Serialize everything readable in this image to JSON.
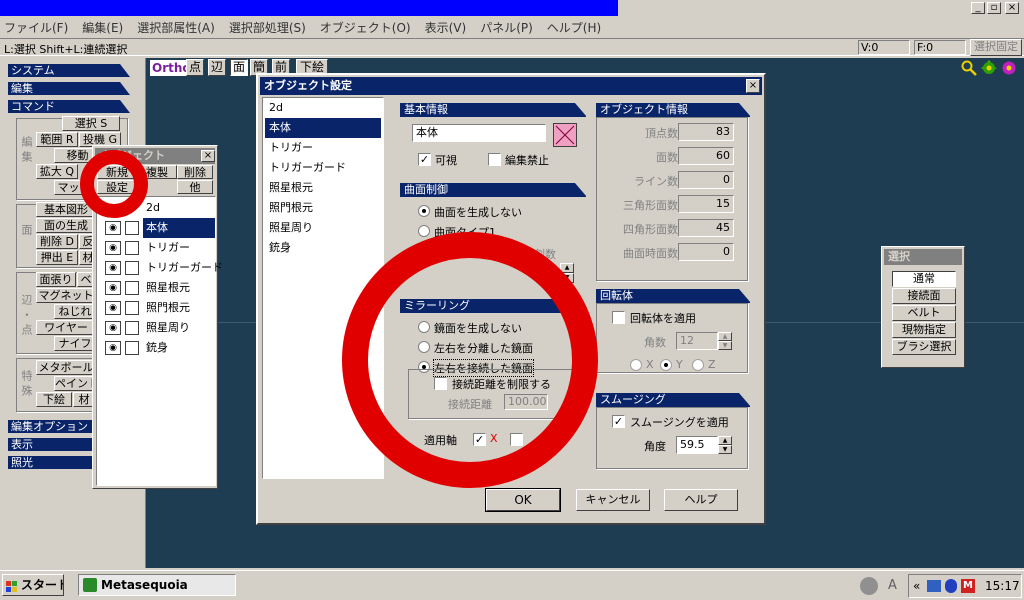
{
  "colors": {
    "title_active": "#0a246a",
    "viewport": "#1e3c52",
    "red_annotation": "#e00000",
    "light_icon": "#e8a000",
    "menu": "#d4d0c8"
  },
  "menubar": {
    "items": [
      "ファイル(F)",
      "編集(E)",
      "選択部属性(A)",
      "選択部処理(S)",
      "オブジェクト(O)",
      "表示(V)",
      "パネル(P)",
      "ヘルプ(H)"
    ]
  },
  "statusbar": {
    "hint": "L:選択  Shift+L:連続選択",
    "v": "V:0",
    "f": "F:0",
    "fixed": "選択固定"
  },
  "left_panel": {
    "headers": [
      "システム",
      "編集",
      "コマンド"
    ],
    "bottom_headers": [
      "編集オプション",
      "表示",
      "照光"
    ],
    "groups": {
      "edit": "編集",
      "face": "面",
      "edge": "辺・点",
      "special": "特殊"
    },
    "buttons": [
      "選択 S",
      "範囲 R",
      "投機 G",
      "移動 V",
      "拡大 Q",
      "マッピ",
      "基本図形",
      "面の生成",
      "削除 D",
      "反",
      "押出 E",
      "材",
      "面張り",
      "ベ",
      "マグネット",
      "ねじれ",
      "ワイヤー",
      "ナイフ",
      "メタボール",
      "ペイント",
      "下絵",
      "材"
    ]
  },
  "toolbar": {
    "ortho": "Ortho",
    "buttons": [
      "点",
      "辺",
      "面",
      "簡",
      "前",
      "下絵"
    ]
  },
  "object_panel": {
    "title": "オブジェクト",
    "buttons": {
      "new": "新規",
      "copy": "複製",
      "delete": "削除",
      "settings": "設定",
      "other": "他"
    },
    "objects": [
      "2d",
      "本体",
      "トリガー",
      "トリガーガード",
      "照星根元",
      "照門根元",
      "照星周り",
      "銃身"
    ],
    "selected_index": 1
  },
  "dialog": {
    "title": "オブジェクト設定",
    "list": [
      "2d",
      "本体",
      "トリガー",
      "トリガーガード",
      "照星根元",
      "照門根元",
      "照星周り",
      "銃身"
    ],
    "selected_index": 1,
    "basic": {
      "header": "基本情報",
      "name": "本体",
      "visible": "可視",
      "visible_checked": true,
      "lock": "編集禁止",
      "lock_checked": false
    },
    "curve": {
      "header": "曲面制御",
      "opt1": "曲面を生成しない",
      "opt2": "曲面タイプ1",
      "partial": "割数"
    },
    "mirror": {
      "header": "ミラーリング",
      "opt1": "鏡面を生成しない",
      "opt2": "左右を分離した鏡面",
      "opt3": "左右を接続した鏡面",
      "limit": "接続距離を制限する",
      "dist_label": "接続距離",
      "dist_value": "100.00",
      "axis_label": "適用軸",
      "axis_x": "X"
    },
    "info": {
      "header": "オブジェクト情報",
      "rows": [
        {
          "label": "頂点数",
          "value": "83"
        },
        {
          "label": "面数",
          "value": "60"
        },
        {
          "label": "ライン数",
          "value": "0"
        },
        {
          "label": "三角形面数",
          "value": "15"
        },
        {
          "label": "四角形面数",
          "value": "45"
        },
        {
          "label": "曲面時面数",
          "value": "0"
        }
      ]
    },
    "rotation": {
      "header": "回転体",
      "apply": "回転体を適用",
      "angle_label": "角数",
      "angle_value": "12",
      "axes": [
        "X",
        "Y",
        "Z"
      ]
    },
    "smoothing": {
      "header": "スムージング",
      "apply": "スムージングを適用",
      "angle_label": "角度",
      "angle_value": "59.5"
    },
    "buttons": {
      "ok": "OK",
      "cancel": "キャンセル",
      "help": "ヘルプ"
    }
  },
  "select_panel": {
    "title": "選択",
    "buttons": [
      "通常",
      "接続面",
      "ベルト",
      "現物指定",
      "ブラシ選択"
    ]
  },
  "taskbar": {
    "start": "スタート",
    "task": "Metasequoia",
    "time": "15:17"
  },
  "window_controls": {
    "minimize": "_",
    "maximize": "▫",
    "close": "×"
  }
}
